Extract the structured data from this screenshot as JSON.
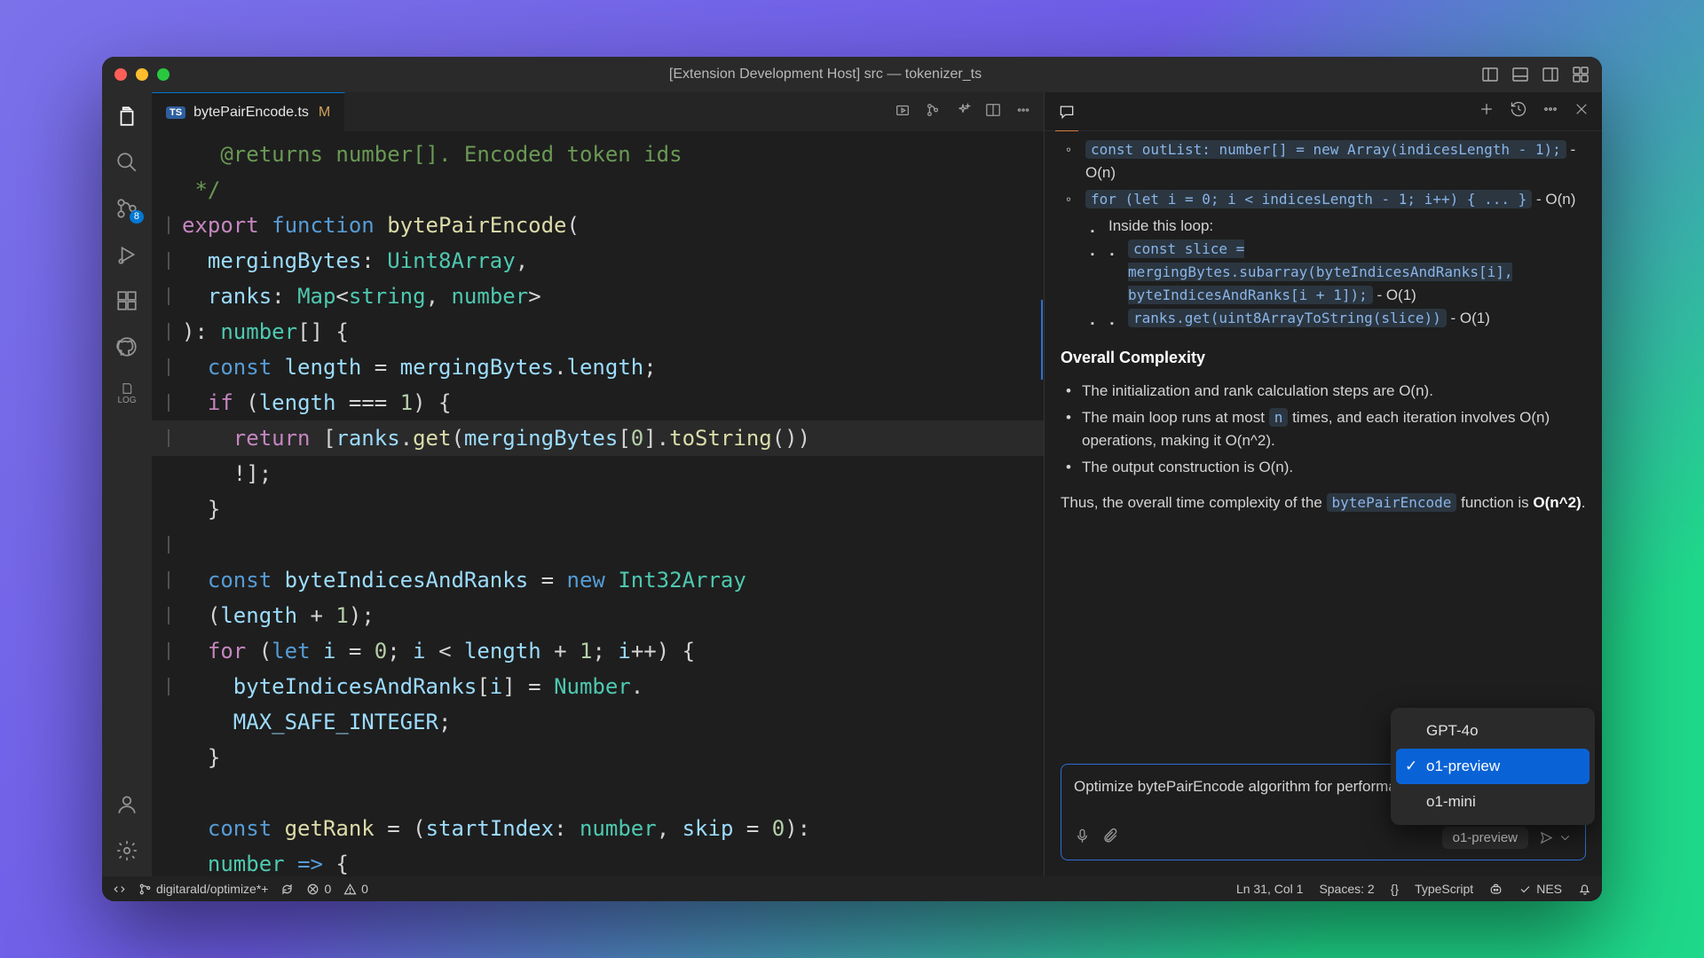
{
  "window_title": "[Extension Development Host] src — tokenizer_ts",
  "tab": {
    "filename": "bytePairEncode.ts",
    "modified_badge": "M",
    "lang_badge": "TS"
  },
  "scm_badge": "8",
  "chat": {
    "bullets_outer": [
      {
        "code": "const outList: number[] = new Array(indicesLength - 1);",
        "complexity": "- O(n)"
      },
      {
        "code": "for (let i = 0; i < indicesLength - 1; i++) { ... }",
        "complexity": "- O(n)"
      }
    ],
    "inside_label": "Inside this loop:",
    "bullets_inner": [
      {
        "code": "const slice = mergingBytes.subarray(byteIndicesAndRanks[i], byteIndicesAndRanks[i + 1]);",
        "complexity": "- O(1)"
      },
      {
        "code": "ranks.get(uint8ArrayToString(slice))",
        "complexity": "- O(1)"
      }
    ],
    "overall_heading": "Overall Complexity",
    "overall_bullets": [
      "The initialization and rank calculation steps are O(n).",
      "The output construction is O(n)."
    ],
    "overall_bullet_with_code_pre": "The main loop runs at most ",
    "overall_bullet_with_code_code": "n",
    "overall_bullet_with_code_post": " times, and each iteration involves O(n) operations, making it O(n^2).",
    "summary_pre": "Thus, the overall time complexity of the ",
    "summary_code": "bytePairEncode",
    "summary_post": " function is ",
    "summary_complexity": "O(n^2)",
    "summary_end": "."
  },
  "input_text": "Optimize bytePairEncode algorithm for performance in node.js",
  "model_pill": "o1-preview",
  "models": {
    "a": "GPT-4o",
    "b": "o1-preview",
    "c": "o1-mini"
  },
  "status": {
    "branch": "digitarald/optimize*+",
    "errors": "0",
    "warnings": "0",
    "cursor": "Ln 31, Col 1",
    "spaces": "Spaces: 2",
    "braces": "{}",
    "lang": "TypeScript",
    "nes": "NES"
  }
}
